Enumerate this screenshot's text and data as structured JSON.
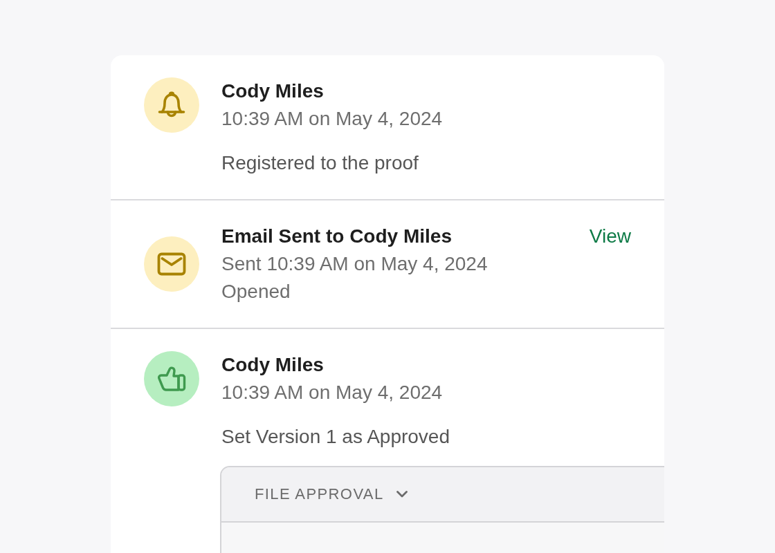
{
  "events": [
    {
      "kind": "registration",
      "title": "Cody Miles",
      "time": "10:39 AM on May 4, 2024",
      "description": "Registered to the proof"
    },
    {
      "kind": "email",
      "title": "Email Sent to Cody Miles",
      "time": "Sent 10:39 AM on May 4, 2024",
      "status": "Opened",
      "link": "View"
    },
    {
      "kind": "approval",
      "title": "Cody Miles",
      "time": "10:39 AM on May 4, 2024",
      "description": "Set Version 1 as Approved",
      "panel": {
        "title": "FILE APPROVAL",
        "expanded": true
      }
    }
  ]
}
